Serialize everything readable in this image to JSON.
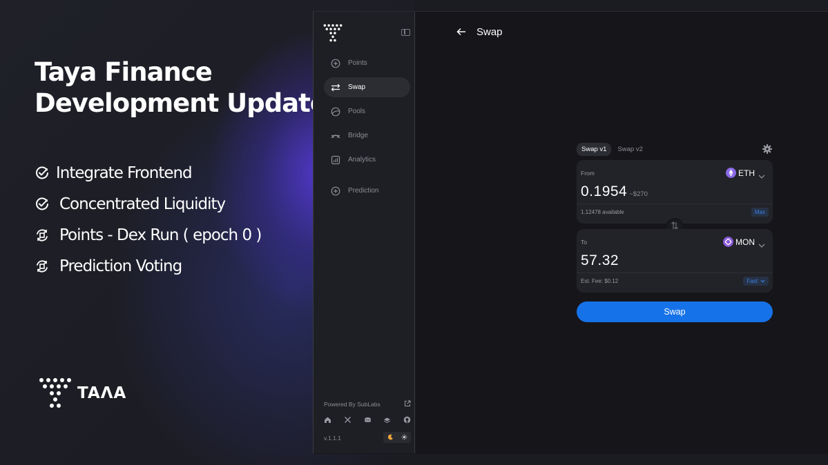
{
  "promo": {
    "title_line1": "Taya Finance",
    "title_line2": "Development Update",
    "items": [
      {
        "label": "Integrate Frontend",
        "icon": "check-circle-icon"
      },
      {
        "label": "Concentrated Liquidity",
        "icon": "check-circle-icon"
      },
      {
        "label": "Points - Dex Run ( epoch 0 )",
        "icon": "in-progress-icon"
      },
      {
        "label": "Prediction Voting",
        "icon": "in-progress-icon"
      }
    ],
    "brand_text": "TAΛA"
  },
  "sidebar": {
    "items": [
      {
        "label": "Points",
        "icon": "plus-circle-icon"
      },
      {
        "label": "Swap",
        "icon": "swap-arrows-icon"
      },
      {
        "label": "Pools",
        "icon": "pools-icon"
      },
      {
        "label": "Bridge",
        "icon": "bridge-icon"
      },
      {
        "label": "Analytics",
        "icon": "analytics-icon"
      },
      {
        "label": "Prediction",
        "icon": "plus-circle-icon"
      }
    ],
    "active": "Swap",
    "powered_by": "Powered By SubLabs",
    "version": "v.1.1.1"
  },
  "header": {
    "title": "Swap"
  },
  "swap": {
    "tabs": [
      "Swap v1",
      "Swap v2"
    ],
    "active_tab": "Swap v1",
    "from": {
      "label": "From",
      "token": "ETH",
      "amount": "0.1954",
      "usd": "~$270",
      "available": "1.12478 available",
      "max_label": "Max"
    },
    "to": {
      "label": "To",
      "token": "MON",
      "amount": "57.32",
      "fee": "Est. Fee: $0.12",
      "speed": "Fast"
    },
    "button_label": "Swap"
  },
  "colors": {
    "accent": "#1672e8",
    "eth": "#8a6ae6",
    "mon": "#8a5ad6",
    "background": "#16161a"
  }
}
